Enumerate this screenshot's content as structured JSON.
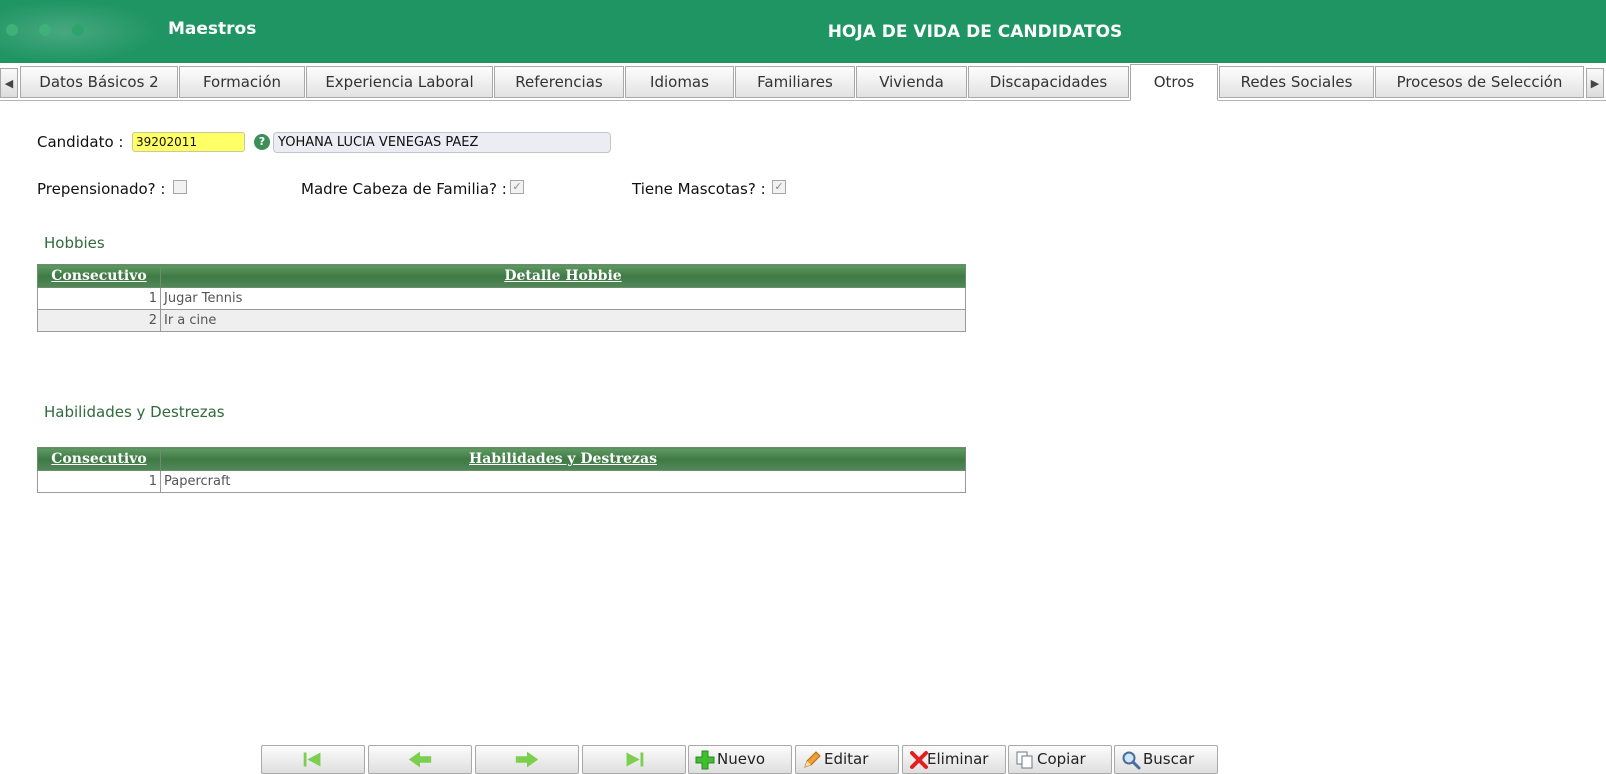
{
  "header": {
    "app_title": "Maestros",
    "page_title": "HOJA DE VIDA DE CANDIDATOS",
    "color": "#1f9563"
  },
  "tabs": [
    {
      "label": "Datos Básicos 2"
    },
    {
      "label": "Formación"
    },
    {
      "label": "Experiencia Laboral"
    },
    {
      "label": "Referencias"
    },
    {
      "label": "Idiomas"
    },
    {
      "label": "Familiares"
    },
    {
      "label": "Vivienda"
    },
    {
      "label": "Discapacidades"
    },
    {
      "label": "Otros",
      "active": true
    },
    {
      "label": "Redes Sociales"
    },
    {
      "label": "Procesos de Selección"
    }
  ],
  "tab_scroll": {
    "left_icon": "triangle-left-icon",
    "right_icon": "triangle-right-icon"
  },
  "candidate": {
    "label": "Candidato :",
    "code": "39202011",
    "name": "YOHANA LUCIA VENEGAS PAEZ",
    "help_icon": "help-circle-icon"
  },
  "flags": {
    "prepensionado": {
      "label": "Prepensionado? :",
      "checked": false
    },
    "madre_cabeza": {
      "label": "Madre Cabeza de Familia? :",
      "checked": true
    },
    "mascotas": {
      "label": "Tiene Mascotas? :",
      "checked": true
    }
  },
  "hobbies": {
    "title": "Hobbies",
    "columns": [
      "Consecutivo",
      "Detalle Hobbie"
    ],
    "rows": [
      {
        "num": "1",
        "detail": "Jugar Tennis"
      },
      {
        "num": "2",
        "detail": "Ir a cine"
      }
    ]
  },
  "skills": {
    "title": "Habilidades y Destrezas",
    "columns": [
      "Consecutivo",
      "Habilidades y Destrezas"
    ],
    "rows": [
      {
        "num": "1",
        "detail": "Papercraft"
      }
    ]
  },
  "toolbar": {
    "first_icon": "first-record-icon",
    "prev_icon": "previous-record-icon",
    "next_icon": "next-record-icon",
    "last_icon": "last-record-icon",
    "nuevo": "Nuevo",
    "editar": "Editar",
    "eliminar": "Eliminar",
    "copiar": "Copiar",
    "buscar": "Buscar"
  }
}
